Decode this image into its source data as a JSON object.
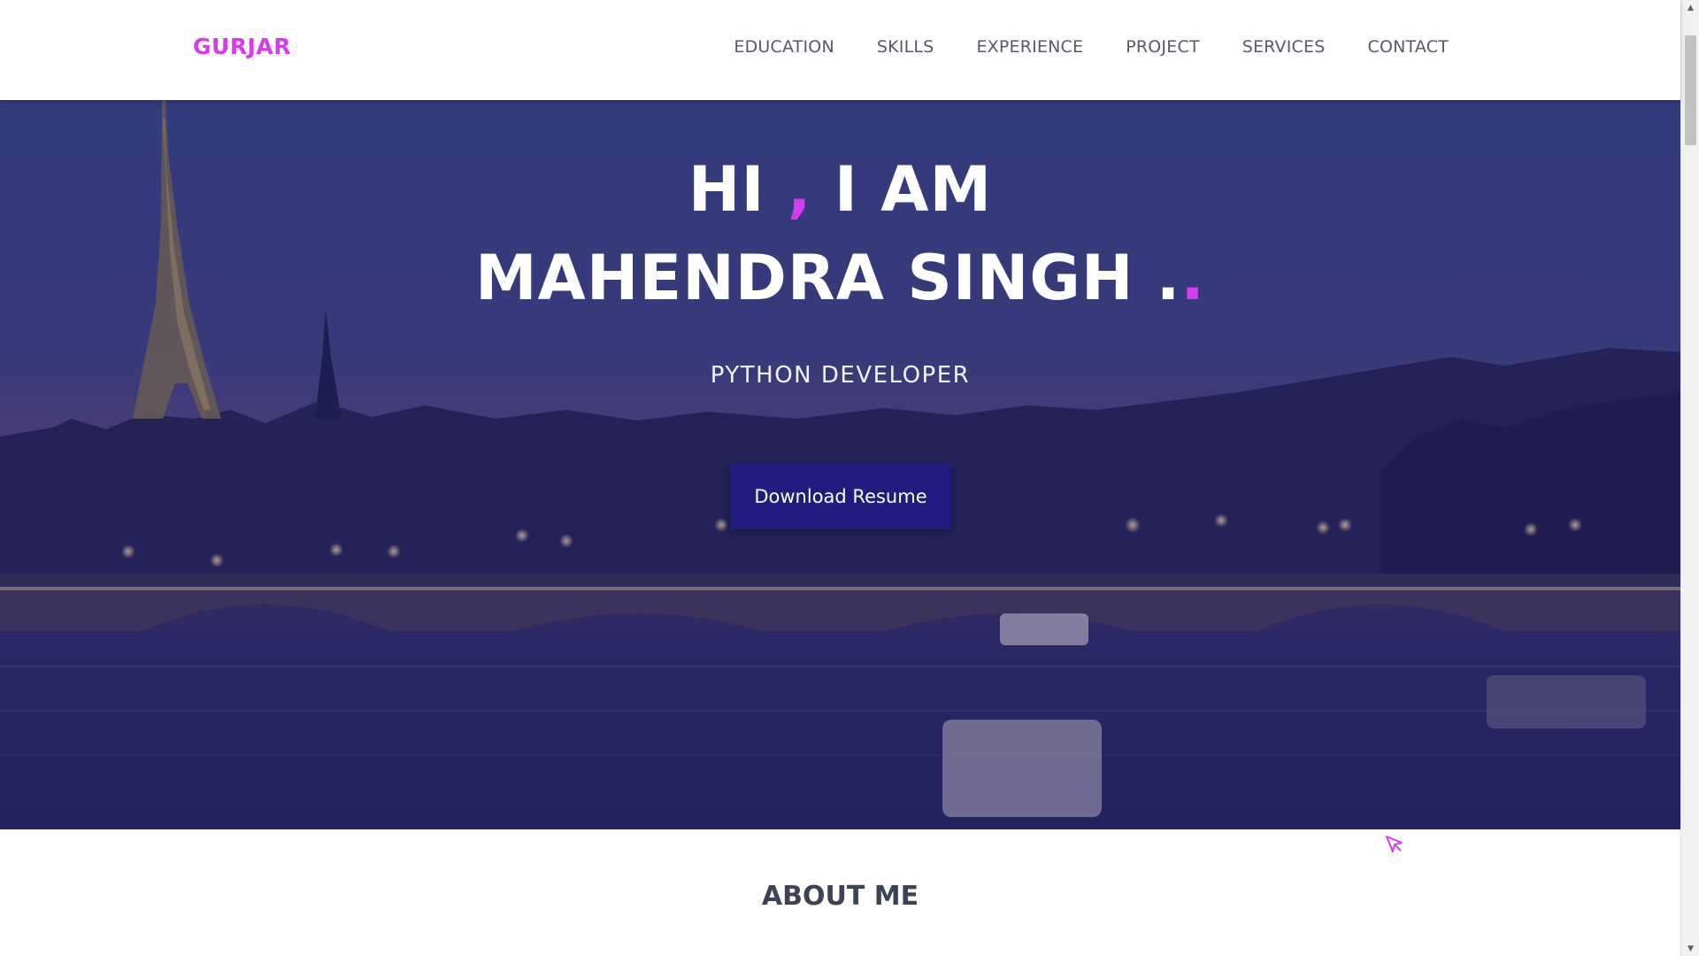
{
  "brand": {
    "name": "GURJAR"
  },
  "nav": {
    "items": [
      {
        "label": "EDUCATION"
      },
      {
        "label": "SKILLS"
      },
      {
        "label": "EXPERIENCE"
      },
      {
        "label": "PROJECT"
      },
      {
        "label": "SERVICES"
      },
      {
        "label": "CONTACT"
      }
    ]
  },
  "hero": {
    "greeting_start": "HI ",
    "greeting_comma": ",",
    "greeting_end": " I AM",
    "name": "MAHENDRA SINGH .",
    "name_dot": ".",
    "role": "PYTHON DEVELOPER",
    "button_label": "Download Resume",
    "background": "night-city-river-bridge-photo"
  },
  "about": {
    "title": "ABOUT ME"
  },
  "icons": {
    "cursor": "pointer-cursor-icon",
    "scroll_up": "triangle-up-icon",
    "scroll_down": "triangle-down-icon"
  },
  "colors": {
    "accent": "#d83af2",
    "button": "#221c80",
    "nav_text": "#555a6a",
    "about_title": "#3d4356",
    "hero_overlay": "#211e64"
  }
}
